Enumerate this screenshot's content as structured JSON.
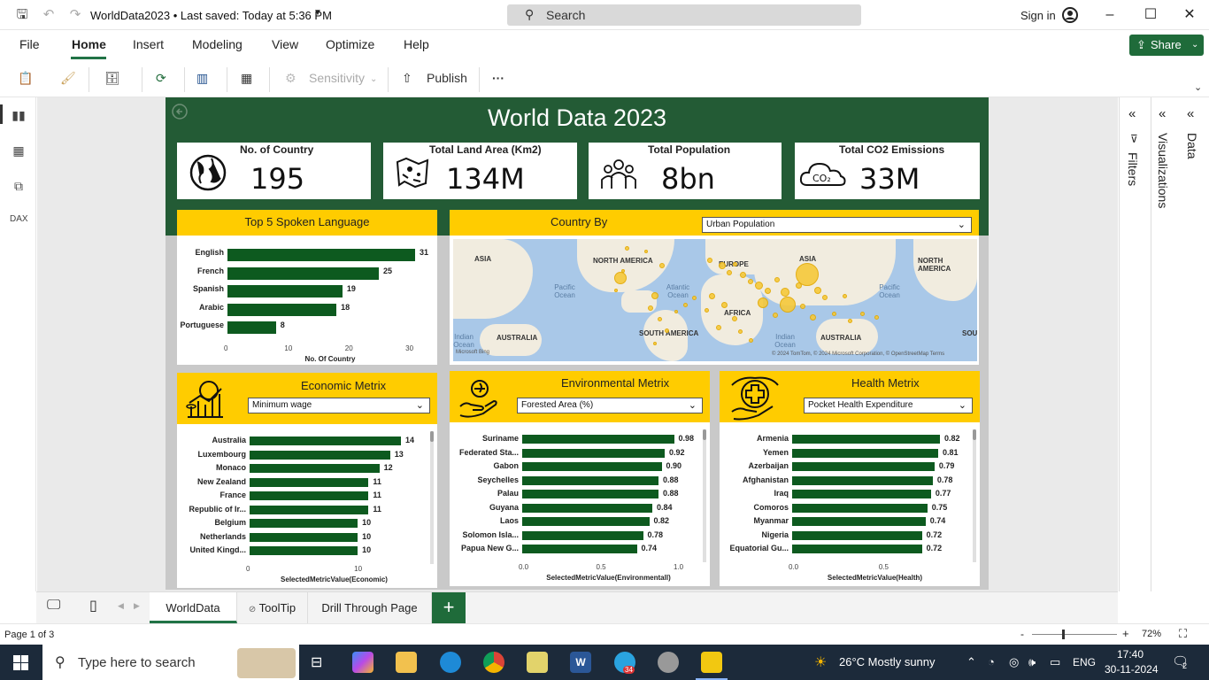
{
  "titlebar": {
    "title": "WorldData2023 • Last saved: Today at 5:36 PM",
    "search_label": "Search",
    "signin": "Sign in"
  },
  "menu": {
    "items": [
      "File",
      "Home",
      "Insert",
      "Modeling",
      "View",
      "Optimize",
      "Help"
    ],
    "share": "Share"
  },
  "ribbon": {
    "sensitivity": "Sensitivity",
    "publish": "Publish",
    "more": "···"
  },
  "report": {
    "title": "World Data 2023",
    "kpis": [
      {
        "label": "No. of Country",
        "value": "195",
        "icon": "globe-icon"
      },
      {
        "label": "Total Land Area (Km2)",
        "value": "134M",
        "icon": "map-icon"
      },
      {
        "label": "Total Population",
        "value": "8bn",
        "icon": "people-icon"
      },
      {
        "label": "Total CO2 Emissions",
        "value": "33M",
        "icon": "co2-cloud-icon"
      }
    ],
    "languages": {
      "header": "Top 5 Spoken Language",
      "axis_title": "No. Of Country",
      "ticks": [
        "0",
        "10",
        "20",
        "30"
      ]
    },
    "map": {
      "header": "Country By",
      "selected": "Urban Population",
      "labels": {
        "asia_left": "ASIA",
        "north_america": "NORTH AMERICA",
        "europe": "EUROPE",
        "asia": "ASIA",
        "north_america_right": "NORTH AMERICA",
        "pacific_left": "Pacific Ocean",
        "atlantic": "Atlantic Ocean",
        "pacific_right": "Pacific Ocean",
        "africa": "AFRICA",
        "indian_left": "Indian Ocean",
        "australia_left": "AUSTRALIA",
        "south_america": "SOUTH AMERICA",
        "indian": "Indian Ocean",
        "australia": "AUSTRALIA",
        "sou": "SOU"
      },
      "attribution": "© 2024 TomTom, © 2024 Microsoft Corporation, © OpenStreetMap  Terms",
      "brand": "Microsoft Bing"
    },
    "economic": {
      "header": "Economic Metrix",
      "selected": "Minimum wage",
      "axis_title": "SelectedMetricValue(Economic)",
      "ticks": [
        "0",
        "10"
      ]
    },
    "environmental": {
      "header": "Environmental Metrix",
      "selected": "Forested Area (%)",
      "axis_title": "SelectedMetricValue(Environmentall)",
      "ticks": [
        "0.0",
        "0.5",
        "1.0"
      ]
    },
    "health": {
      "header": "Health Metrix",
      "selected": "Pocket Health Expenditure",
      "axis_title": "SelectedMetricValue(Health)",
      "ticks": [
        "0.0",
        "0.5"
      ]
    }
  },
  "chart_data": [
    {
      "type": "bar",
      "orientation": "horizontal",
      "title": "Top 5 Spoken Language",
      "xlabel": "No. Of Country",
      "categories": [
        "English",
        "French",
        "Spanish",
        "Arabic",
        "Portuguese"
      ],
      "values": [
        31,
        25,
        19,
        18,
        8
      ],
      "xlim": [
        0,
        31
      ]
    },
    {
      "type": "bar",
      "orientation": "horizontal",
      "title": "Economic Metrix",
      "xlabel": "SelectedMetricValue(Economic)",
      "categories": [
        "Australia",
        "Luxembourg",
        "Monaco",
        "New Zealand",
        "France",
        "Republic of Ir...",
        "Belgium",
        "Netherlands",
        "United Kingd..."
      ],
      "values": [
        14,
        13,
        12,
        11,
        11,
        11,
        10,
        10,
        10
      ],
      "xlim": [
        0,
        14
      ]
    },
    {
      "type": "bar",
      "orientation": "horizontal",
      "title": "Environmental Metrix",
      "xlabel": "SelectedMetricValue(Environmentall)",
      "categories": [
        "Suriname",
        "Federated Sta...",
        "Gabon",
        "Seychelles",
        "Palau",
        "Guyana",
        "Laos",
        "Solomon Isla...",
        "Papua New G..."
      ],
      "values": [
        0.98,
        0.92,
        0.9,
        0.88,
        0.88,
        0.84,
        0.82,
        0.78,
        0.74
      ],
      "xlim": [
        0,
        1.0
      ]
    },
    {
      "type": "bar",
      "orientation": "horizontal",
      "title": "Health Metrix",
      "xlabel": "SelectedMetricValue(Health)",
      "categories": [
        "Armenia",
        "Yemen",
        "Azerbaijan",
        "Afghanistan",
        "Iraq",
        "Comoros",
        "Myanmar",
        "Nigeria",
        "Equatorial Gu..."
      ],
      "values": [
        0.82,
        0.81,
        0.79,
        0.78,
        0.77,
        0.75,
        0.74,
        0.72,
        0.72
      ],
      "xlim": [
        0,
        0.82
      ]
    }
  ],
  "side_panes": {
    "filters": "Filters",
    "visualizations": "Visualizations",
    "data": "Data"
  },
  "pages": {
    "tabs": [
      "WorldData",
      "ToolTip",
      "Drill Through Page"
    ],
    "add": "+"
  },
  "status": {
    "page": "Page 1 of 3",
    "zoom": "72%"
  },
  "taskbar": {
    "search": "Type here to search",
    "weather": "26°C  Mostly sunny",
    "lang": "ENG",
    "time": "17:40",
    "date": "30-11-2024",
    "telegram_badge": "34",
    "notif_badge": "2"
  },
  "colors": {
    "brand_green": "#235b35",
    "accent_yellow": "#ffcc00",
    "bar_green": "#0d5a1f"
  }
}
